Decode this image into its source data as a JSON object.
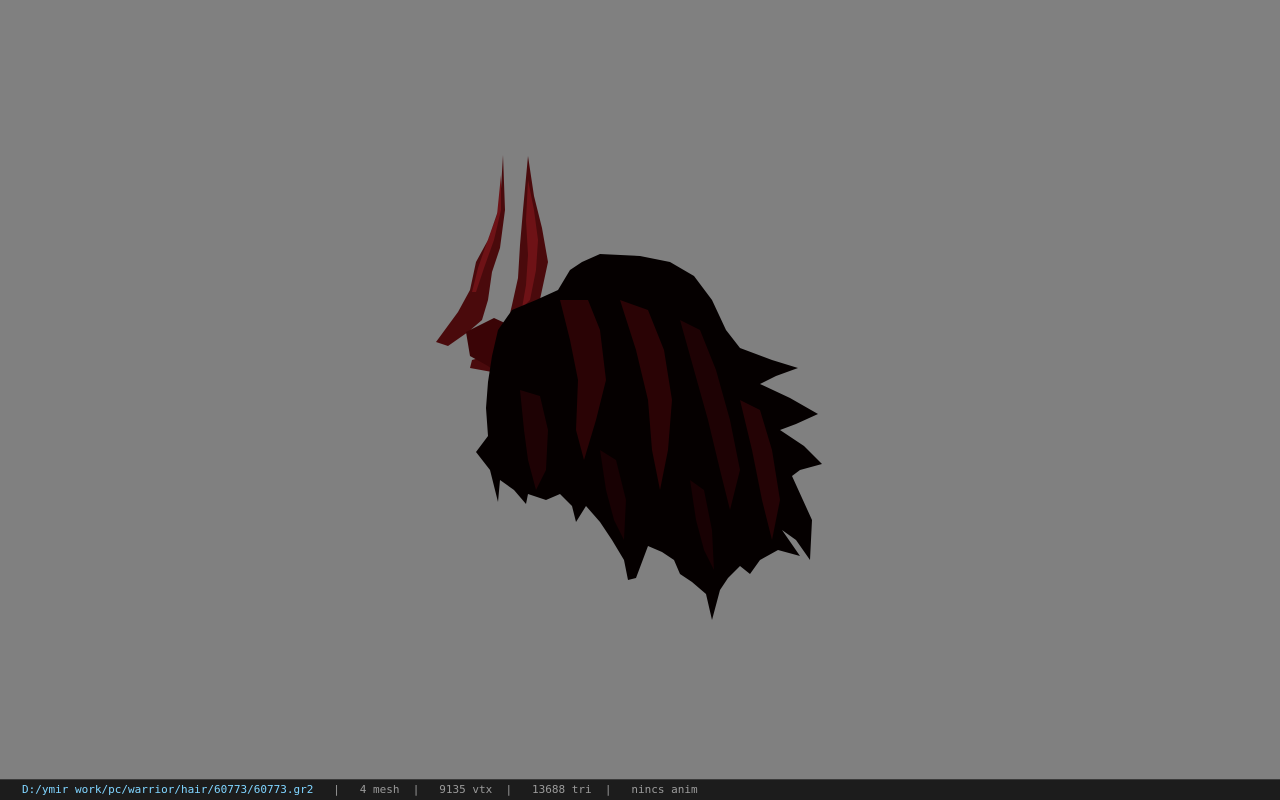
{
  "viewport": {
    "background_color": "#808080",
    "model_colors": {
      "hair": "#050000",
      "hair_highlight": "#3a0406",
      "horn": "#4a0a0c",
      "horn_highlight": "#6e1216"
    }
  },
  "statusbar": {
    "file_path": "D:/ymir work/pc/warrior/hair/60773/60773.gr2",
    "separator": "|",
    "mesh_count": "4 mesh",
    "vertex_count": "9135 vtx",
    "triangle_count": "13688 tri",
    "anim_status": "nincs anim",
    "path_color": "#7fd4ff",
    "text_color": "#9a9a9a"
  }
}
